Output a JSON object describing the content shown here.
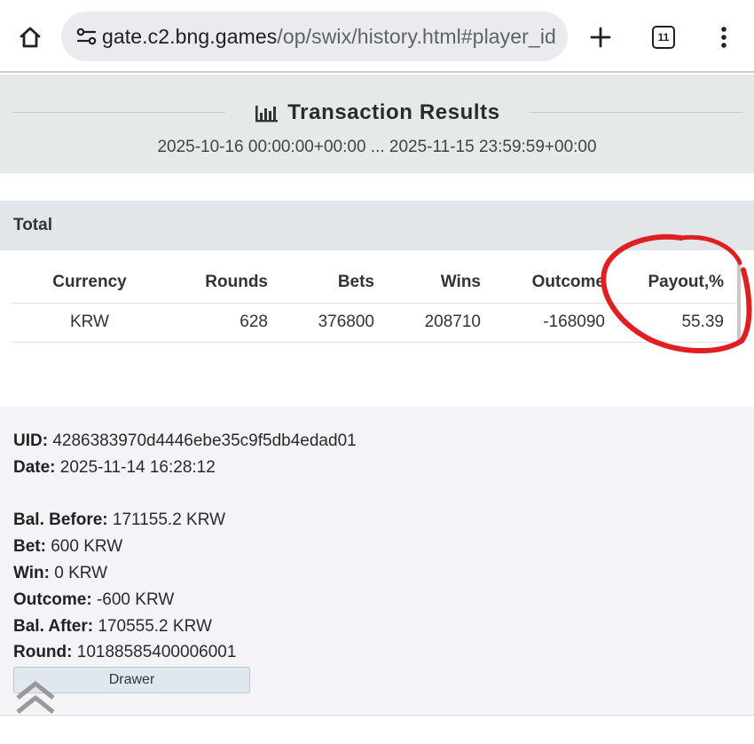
{
  "browser": {
    "url_host": "gate.c2.bng.games",
    "url_path": "/op/swix/history.html#player_id",
    "tab_count": "11",
    "icons": {
      "home": "home-icon",
      "site_settings": "tune-icon",
      "new_tab": "plus-icon",
      "tabs": "tab-switcher-icon",
      "menu": "more-vert-icon"
    }
  },
  "header": {
    "title": "Transaction Results",
    "title_icon": "bar-chart-icon",
    "date_range": "2025-10-16 00:00:00+00:00 ... 2025-11-15 23:59:59+00:00"
  },
  "total": {
    "label": "Total",
    "columns": [
      "Currency",
      "Rounds",
      "Bets",
      "Wins",
      "Outcome",
      "Payout,%"
    ],
    "rows": [
      [
        "KRW",
        "628",
        "376800",
        "208710",
        "-168090",
        "55.39"
      ]
    ],
    "annotation_color": "#e02020"
  },
  "detail": {
    "uid_label": "UID:",
    "uid": "4286383970d4446ebe35c9f5db4edad01",
    "date_label": "Date:",
    "date": "2025-11-14 16:28:12",
    "bal_before_label": "Bal. Before:",
    "bal_before": "171155.2 KRW",
    "bet_label": "Bet:",
    "bet": "600 KRW",
    "win_label": "Win:",
    "win": "0 KRW",
    "outcome_label": "Outcome:",
    "outcome": "-600 KRW",
    "bal_after_label": "Bal. After:",
    "bal_after": "170555.2 KRW",
    "round_label": "Round:",
    "round": "10188585400006001",
    "drawer_label": "Drawer",
    "scroll_top_icon": "double-chevron-up-icon"
  },
  "colors": {
    "header_bg": "#e4e9e9",
    "total_bg": "#e3e6e8",
    "detail_bg": "#f4f3f7",
    "drawer_bg": "#dfe7ef"
  }
}
